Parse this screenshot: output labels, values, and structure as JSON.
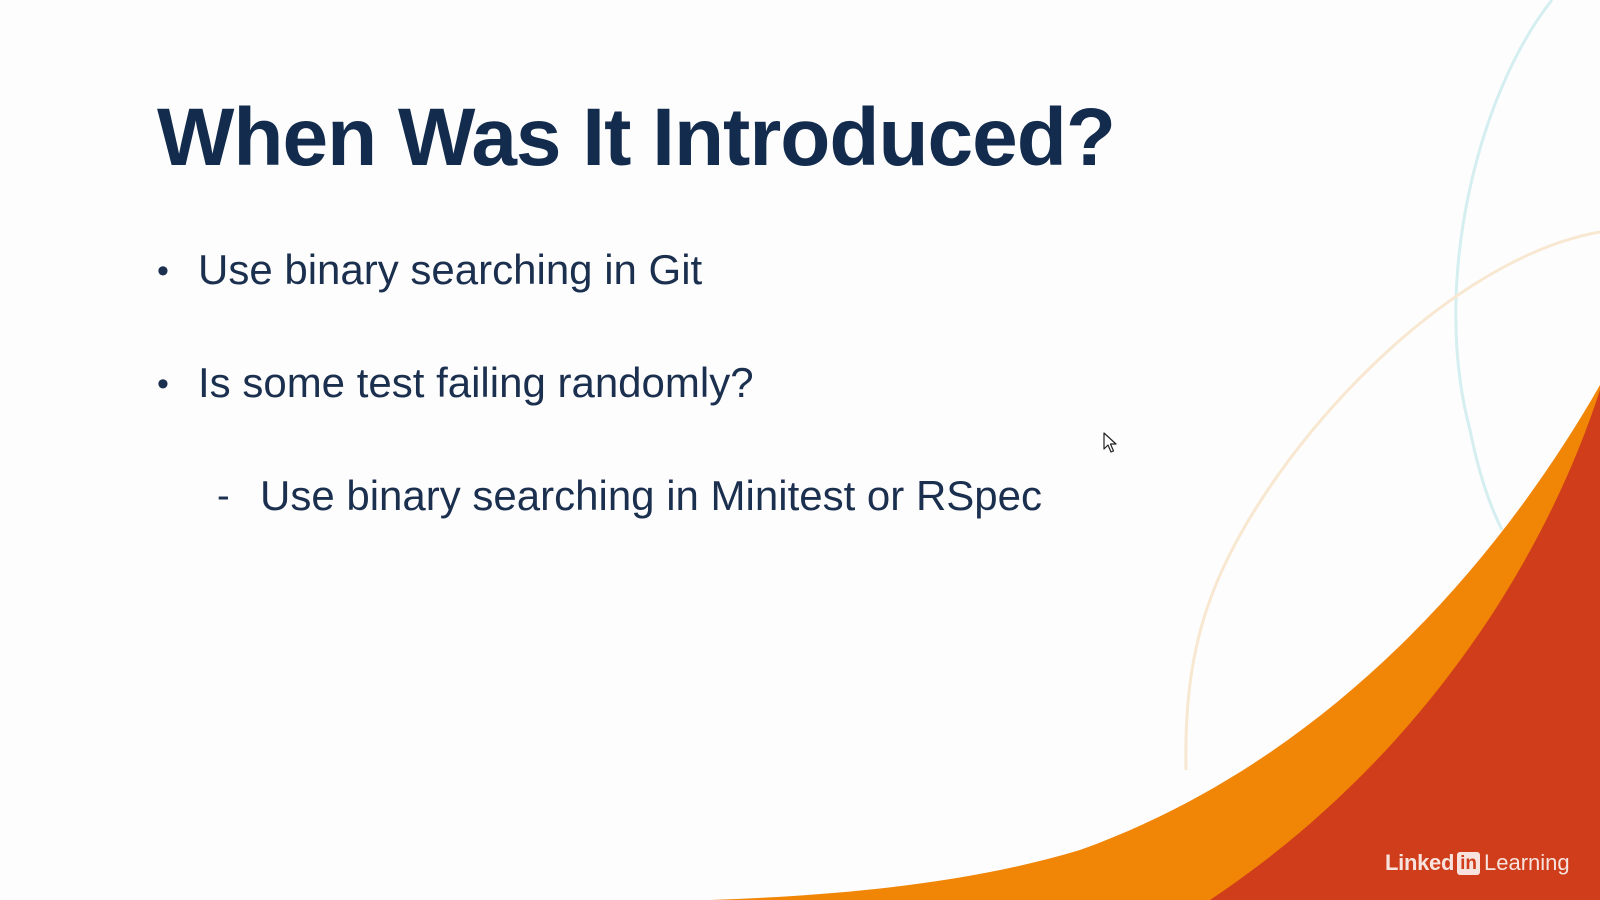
{
  "slide": {
    "title": "When Was It Introduced?",
    "bullets": [
      {
        "marker": "•",
        "text": "Use binary searching in Git",
        "level": 1
      },
      {
        "marker": "•",
        "text": "Is some test failing randomly?",
        "level": 1
      },
      {
        "marker": "-",
        "text": "Use binary searching in Minitest or RSpec",
        "level": 2
      }
    ]
  },
  "branding": {
    "word_a": "Linked",
    "in_mark": "in",
    "word_b": "Learning"
  },
  "colors": {
    "title": "#132c4d",
    "body_text": "#1b2f4e",
    "orange_swoosh": "#f18505",
    "red_swoosh": "#cf3d1a",
    "teal_curve": "#d5eef0",
    "peach_curve": "#f8e8d2",
    "background": "#fdfdfd"
  },
  "icons": {
    "cursor": "mouse-pointer-icon",
    "logo": "linkedin-learning-logo"
  }
}
